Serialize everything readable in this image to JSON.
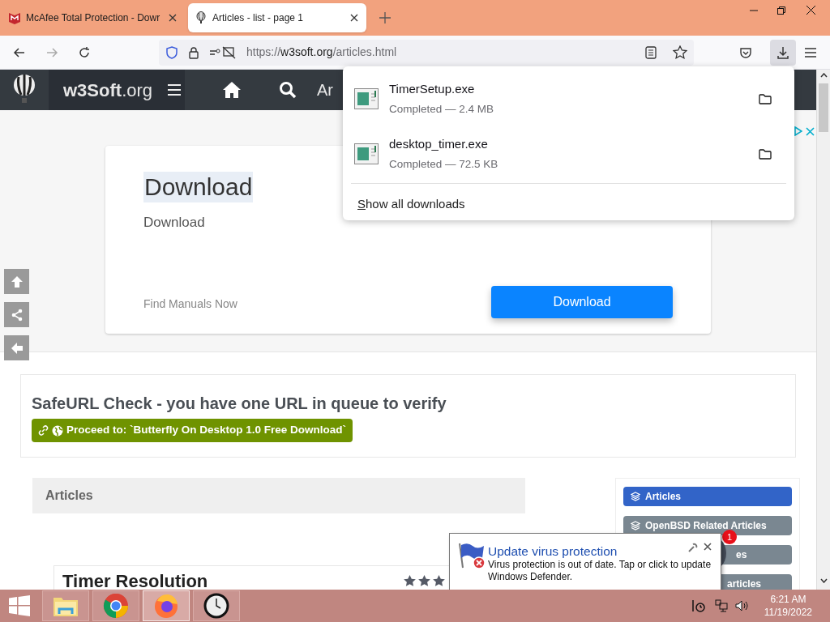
{
  "browser": {
    "tabs": [
      {
        "title": "McAfee Total Protection - Dowr",
        "selected": false
      },
      {
        "title": "Articles - list - page 1",
        "selected": true
      }
    ],
    "url": {
      "scheme": "https://",
      "host": "w3soft.org",
      "path": "/articles.html"
    }
  },
  "site_header": {
    "brand": "**w3Soft**.org",
    "nav_cut": "Ar"
  },
  "downloads": {
    "items": [
      {
        "name": "TimerSetup.exe",
        "status": "Completed — 2.4 MB"
      },
      {
        "name": "desktop_timer.exe",
        "status": "Completed — 72.5 KB"
      }
    ],
    "footer": "Show all downloads"
  },
  "ad": {
    "title": "Download",
    "subtitle": "Download",
    "footer": "Find Manuals Now",
    "button": "Download"
  },
  "safeurl": {
    "heading": "SafeURL Check - you have one URL in queue to verify",
    "button": "Proceed to: `Butterfly On Desktop 1.0 Free Download`"
  },
  "articles_header": "Articles",
  "sidebar": {
    "items": [
      {
        "label": "Articles",
        "selected": true,
        "kind": "full"
      },
      {
        "label": "OpenBSD Related Articles",
        "selected": false,
        "kind": "full"
      },
      {
        "label": "es",
        "selected": false,
        "kind": "covered"
      },
      {
        "label": "articles",
        "selected": false,
        "kind": "covered"
      }
    ]
  },
  "article": {
    "title": "Timer Resolution",
    "stars": 3
  },
  "chat_badge": "1",
  "notification": {
    "title": "Update virus protection",
    "message": "Virus protection is out of date. Tap or click to update Windows Defender."
  },
  "taskbar": {
    "apps": [
      {
        "kind": "explorer",
        "selected": false
      },
      {
        "kind": "chrome",
        "selected": false
      },
      {
        "kind": "firefox",
        "selected": true
      },
      {
        "kind": "clock",
        "selected": false
      }
    ],
    "time": "6:21 AM",
    "date": "11/19/2022"
  }
}
